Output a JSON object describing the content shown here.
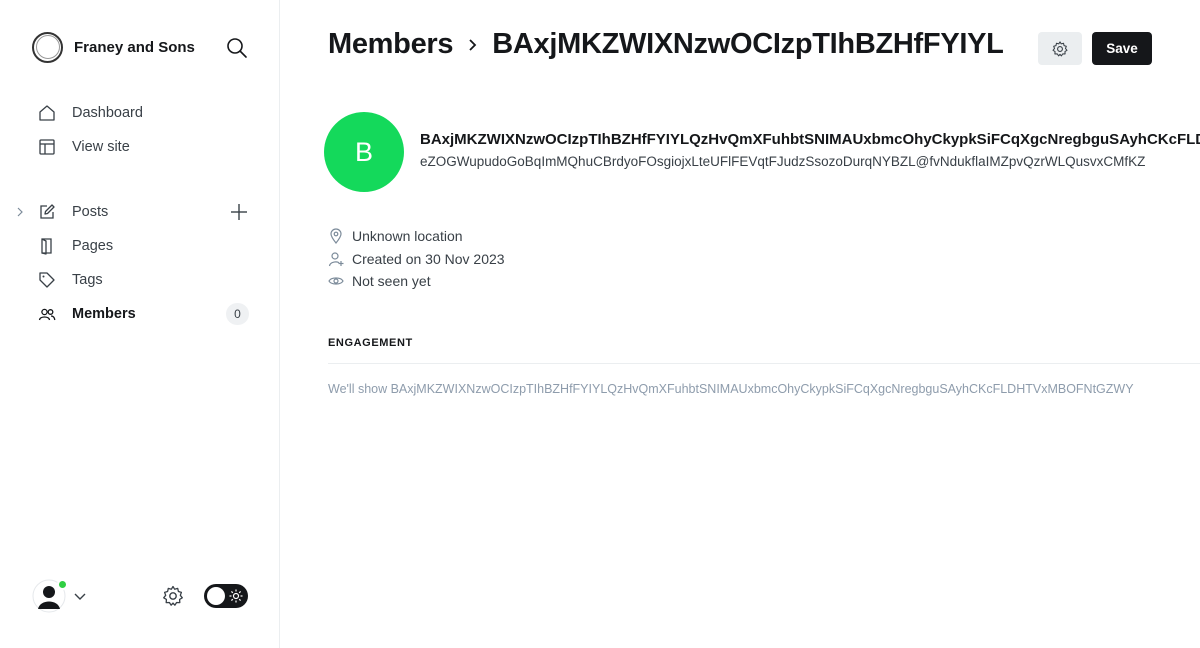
{
  "sidebar": {
    "brand": "Franey and Sons",
    "nav_primary": [
      {
        "label": "Dashboard",
        "icon": "house-icon"
      },
      {
        "label": "View site",
        "icon": "layout-icon"
      }
    ],
    "nav_secondary": [
      {
        "label": "Posts",
        "icon": "pencil-icon"
      },
      {
        "label": "Pages",
        "icon": "page-icon"
      },
      {
        "label": "Tags",
        "icon": "tag-icon"
      },
      {
        "label": "Members",
        "icon": "members-icon",
        "count": "0"
      }
    ]
  },
  "header": {
    "parent": "Members",
    "current": "BAxjMKZWIXNzwOCIzpTIhBZHfFYIYL",
    "save_label": "Save"
  },
  "member": {
    "initial": "B",
    "avatar_color": "#14d95b",
    "name": "BAxjMKZWIXNzwOCIzpTIhBZHfFYIYLQzHvQmXFuhbtSNIMAUxbmcOhyCkypkSiFCqXgcNregbguSAyhCKcFLDHTVxMBOFNtGZWY",
    "email": "eZOGWupudoGoBqImMQhuCBrdyoFOsgiojxLteUFlFEVqtFJudzSsozoDurqNYBZL@fvNdukflaIMZpvQzrWLQusvxCMfKZ",
    "location": "Unknown location",
    "created": "Created on 30 Nov 2023",
    "seen": "Not seen yet"
  },
  "engagement": {
    "title": "ENGAGEMENT",
    "text": "We'll show BAxjMKZWIXNzwOCIzpTIhBZHfFYIYLQzHvQmXFuhbtSNIMAUxbmcOhyCkypkSiFCqXgcNregbguSAyhCKcFLDHTVxMBOFNtGZWY"
  },
  "colors": {
    "accent": "#15171a",
    "online": "#30cf43"
  }
}
